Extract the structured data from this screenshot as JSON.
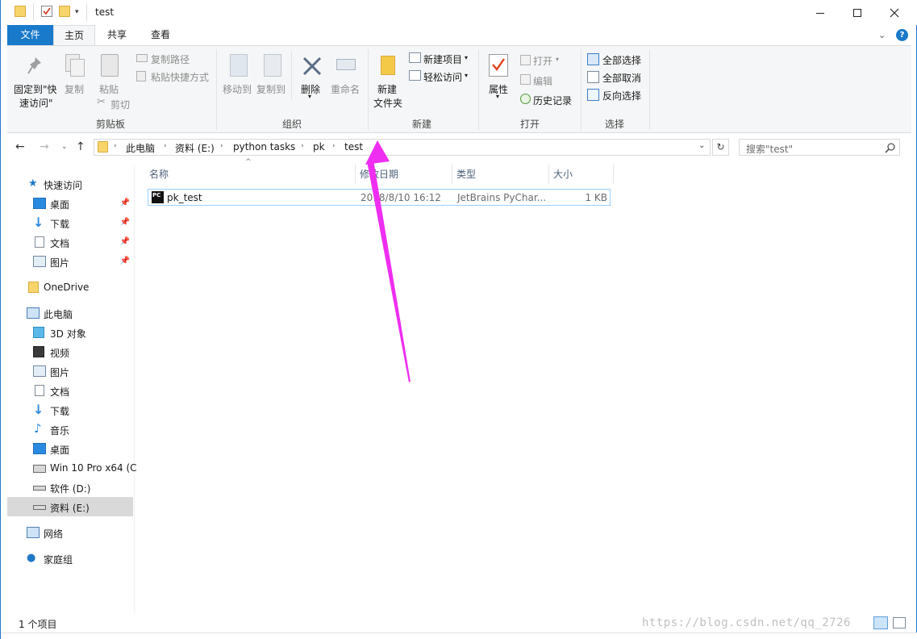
{
  "window": {
    "title": "test"
  },
  "tabs": {
    "file": "文件",
    "home": "主页",
    "share": "共享",
    "view": "查看"
  },
  "ribbon": {
    "clipboard": {
      "pin_label_1": "固定到\"快",
      "pin_label_2": "速访问\"",
      "copy": "复制",
      "paste": "粘贴",
      "copy_path": "复制路径",
      "paste_shortcut": "粘贴快捷方式",
      "cut": "剪切",
      "group": "剪贴板"
    },
    "organize": {
      "move_to": "移动到",
      "copy_to": "复制到",
      "delete": "删除",
      "rename": "重命名",
      "group": "组织"
    },
    "new": {
      "new_folder_1": "新建",
      "new_folder_2": "文件夹",
      "new_item": "新建项目",
      "easy_access": "轻松访问",
      "group": "新建"
    },
    "open": {
      "properties": "属性",
      "open": "打开",
      "edit": "编辑",
      "history": "历史记录",
      "group": "打开"
    },
    "select": {
      "select_all": "全部选择",
      "select_none": "全部取消",
      "invert": "反向选择",
      "group": "选择"
    }
  },
  "address": {
    "crumbs": [
      "此电脑",
      "资料 (E:)",
      "python tasks",
      "pk",
      "test"
    ],
    "search_placeholder": "搜索\"test\""
  },
  "nav": {
    "quick_access": "快速访问",
    "desktop": "桌面",
    "downloads": "下载",
    "documents": "文档",
    "pictures": "图片",
    "onedrive": "OneDrive",
    "this_pc": "此电脑",
    "objects_3d": "3D 对象",
    "videos": "视频",
    "pictures2": "图片",
    "documents2": "文档",
    "downloads2": "下载",
    "music": "音乐",
    "desktop2": "桌面",
    "win10": "Win 10 Pro x64 (C",
    "drive_d": "软件 (D:)",
    "drive_e": "资料 (E:)",
    "network": "网络",
    "homegroup": "家庭组"
  },
  "list": {
    "headers": {
      "name": "名称",
      "date": "修改日期",
      "type": "类型",
      "size": "大小"
    },
    "files": [
      {
        "name": "pk_test",
        "date": "2018/8/10 16:12",
        "type": "JetBrains PyChar...",
        "size": "1 KB"
      }
    ]
  },
  "status": {
    "count": "1 个项目"
  },
  "watermark": "https://blog.csdn.net/qq_2726",
  "colors": {
    "accent": "#1979ca",
    "arrow": "#ee2ef0",
    "selection_border": "#99d1ff"
  }
}
